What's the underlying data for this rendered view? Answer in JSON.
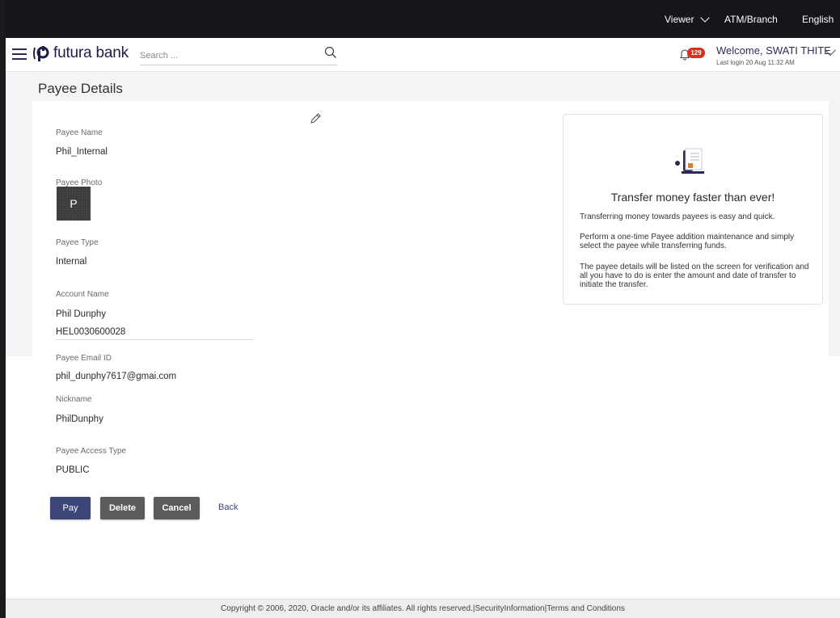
{
  "topbar": {
    "viewer": "Viewer",
    "atm_branch": "ATM/Branch",
    "language": "English"
  },
  "header": {
    "brand": "futura bank",
    "search_placeholder": "Search ...",
    "notification_count": "129",
    "welcome": "Welcome, SWATI THITE",
    "last_login": "Last login 20 Aug 11:32 AM"
  },
  "page": {
    "title": "Payee Details"
  },
  "details": {
    "payee_name_label": "Payee Name",
    "payee_name": "Phil_Internal",
    "payee_photo_label": "Payee Photo",
    "avatar_initial": "P",
    "payee_type_label": "Payee Type",
    "payee_type": "Internal",
    "account_name_label": "Account Name",
    "account_name": "Phil Dunphy",
    "account_number": "HEL0030600028",
    "email_label": "Payee Email ID",
    "email": "phil_dunphy7617@gmai.com",
    "nickname_label": "Nickname",
    "nickname": "PhilDunphy",
    "access_type_label": "Payee Access Type",
    "access_type": "PUBLIC"
  },
  "info_panel": {
    "title": "Transfer money faster than ever!",
    "p1": "Transferring money towards payees is easy and quick.",
    "p2": "Perform a one-time Payee addition maintenance and simply select the payee while transferring funds.",
    "p3": "The payee details will be listed on the screen for verification and all you have to do is enter the amount and date of transfer to initiate the transfer."
  },
  "actions": {
    "pay": "Pay",
    "delete": "Delete",
    "cancel": "Cancel",
    "back": "Back"
  },
  "footer": {
    "text": "Copyright © 2006, 2020, Oracle and/or its affiliates. All rights reserved.|SecurityInformation|Terms and Conditions"
  },
  "colors": {
    "topbar_bg": "#15151b",
    "brand_navy": "#1d1d4a",
    "primary_button": "#3d4577",
    "secondary_button": "#5c5c5c",
    "badge": "#d6301b"
  },
  "icons": [
    "hamburger-icon",
    "bank-logo-icon",
    "search-icon",
    "bell-icon",
    "chevron-down-icon",
    "pencil-edit-icon",
    "document-transfer-icon"
  ]
}
